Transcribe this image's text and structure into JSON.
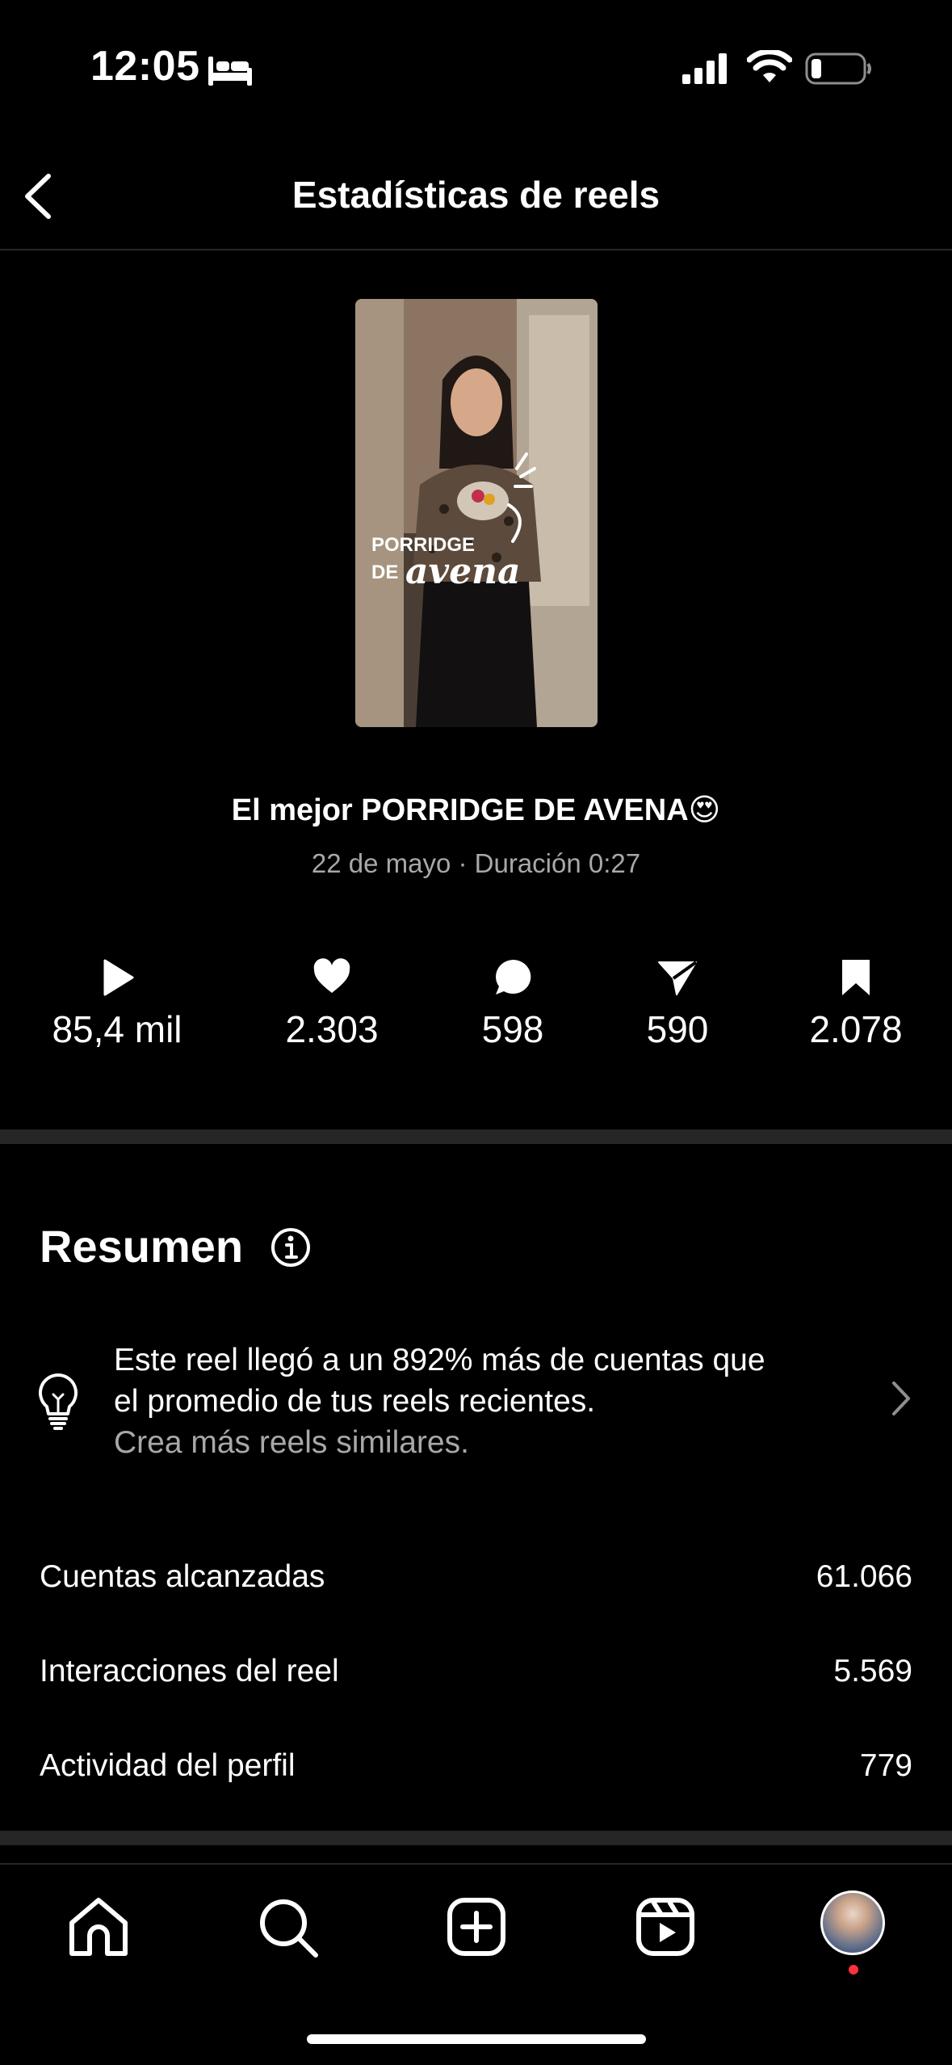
{
  "status_bar": {
    "time": "12:05"
  },
  "header": {
    "title": "Estadísticas de reels"
  },
  "thumbnail": {
    "overlay_line1": "PORRIDGE",
    "overlay_line2_prefix": "DE",
    "overlay_line2_script": "avena"
  },
  "reel": {
    "caption": "El mejor PORRIDGE DE AVENA😍",
    "meta": "22 de mayo · Duración 0:27"
  },
  "stats": {
    "plays": "85,4 mil",
    "likes": "2.303",
    "comments": "598",
    "shares": "590",
    "saves": "2.078"
  },
  "summary": {
    "title": "Resumen",
    "insight_line1": "Este reel llegó a un 892% más de cuentas que",
    "insight_line2": "el promedio de tus reels recientes.",
    "insight_sub": "Crea más reels similares.",
    "metrics": [
      {
        "label": "Cuentas alcanzadas",
        "value": "61.066"
      },
      {
        "label": "Interacciones del reel",
        "value": "5.569"
      },
      {
        "label": "Actividad del perfil",
        "value": "779"
      }
    ]
  },
  "icons": {
    "back": "chevron-left-icon",
    "info": "info-icon",
    "insight": "lightbulb-icon",
    "nav": [
      "home-icon",
      "search-icon",
      "create-icon",
      "reels-icon",
      "profile-avatar"
    ]
  },
  "colors": {
    "background": "#000000",
    "text": "#ffffff",
    "secondary_text": "#a8a8a8",
    "divider": "#262626",
    "notification": "#ff3040"
  }
}
